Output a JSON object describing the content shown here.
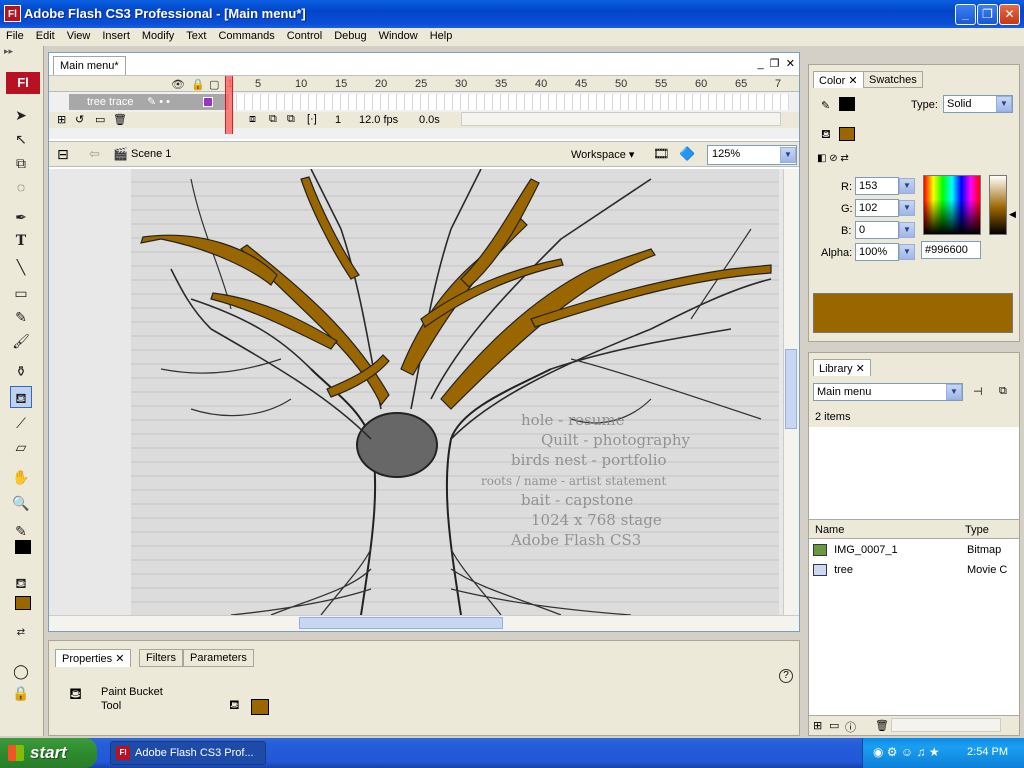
{
  "window": {
    "title": "Adobe Flash CS3 Professional - [Main menu*]",
    "app_icon": "Fl"
  },
  "menubar": [
    "File",
    "Edit",
    "View",
    "Insert",
    "Modify",
    "Text",
    "Commands",
    "Control",
    "Debug",
    "Window",
    "Help"
  ],
  "tools": {
    "logo": "Fl",
    "stroke_color": "#000000",
    "fill_color": "#996600"
  },
  "document": {
    "tab_label": "Main menu*",
    "timeline": {
      "frame_numbers": [
        "1",
        "5",
        "10",
        "15",
        "20",
        "25",
        "30",
        "35",
        "40",
        "45",
        "50",
        "55",
        "60",
        "65",
        "7"
      ],
      "layer_name": "tree trace",
      "current_frame": "1",
      "fps": "12.0 fps",
      "time": "0.0s"
    },
    "edit_bar": {
      "scene": "Scene 1",
      "workspace": "Workspace",
      "zoom": "125%"
    },
    "stage_text_lines": [
      "hole - resume",
      "Quilt - photography",
      "birds nest - portfolio",
      "roots / name - artist statement",
      "bait - capstone",
      "1024 x 768 stage",
      "Adobe Flash CS3"
    ]
  },
  "properties": {
    "tabs": [
      "Properties",
      "Filters",
      "Parameters"
    ],
    "tool_name_line1": "Paint Bucket",
    "tool_name_line2": "Tool",
    "fill_color": "#996600",
    "help": "?"
  },
  "color_panel": {
    "tabs": [
      "Color",
      "Swatches"
    ],
    "type_label": "Type:",
    "type_value": "Solid",
    "r_label": "R:",
    "r": "153",
    "g_label": "G:",
    "g": "102",
    "b_label": "B:",
    "b": "0",
    "alpha_label": "Alpha:",
    "alpha": "100%",
    "hex": "#996600",
    "stroke_color": "#000000",
    "fill_color": "#996600"
  },
  "library_panel": {
    "tab": "Library",
    "document": "Main menu",
    "item_count": "2 items",
    "col_name": "Name",
    "col_type": "Type",
    "items": [
      {
        "name": "IMG_0007_1",
        "type": "Bitmap"
      },
      {
        "name": "tree",
        "type": "Movie C"
      }
    ]
  },
  "taskbar": {
    "start": "start",
    "task": "Adobe Flash CS3 Prof...",
    "clock": "2:54 PM"
  }
}
